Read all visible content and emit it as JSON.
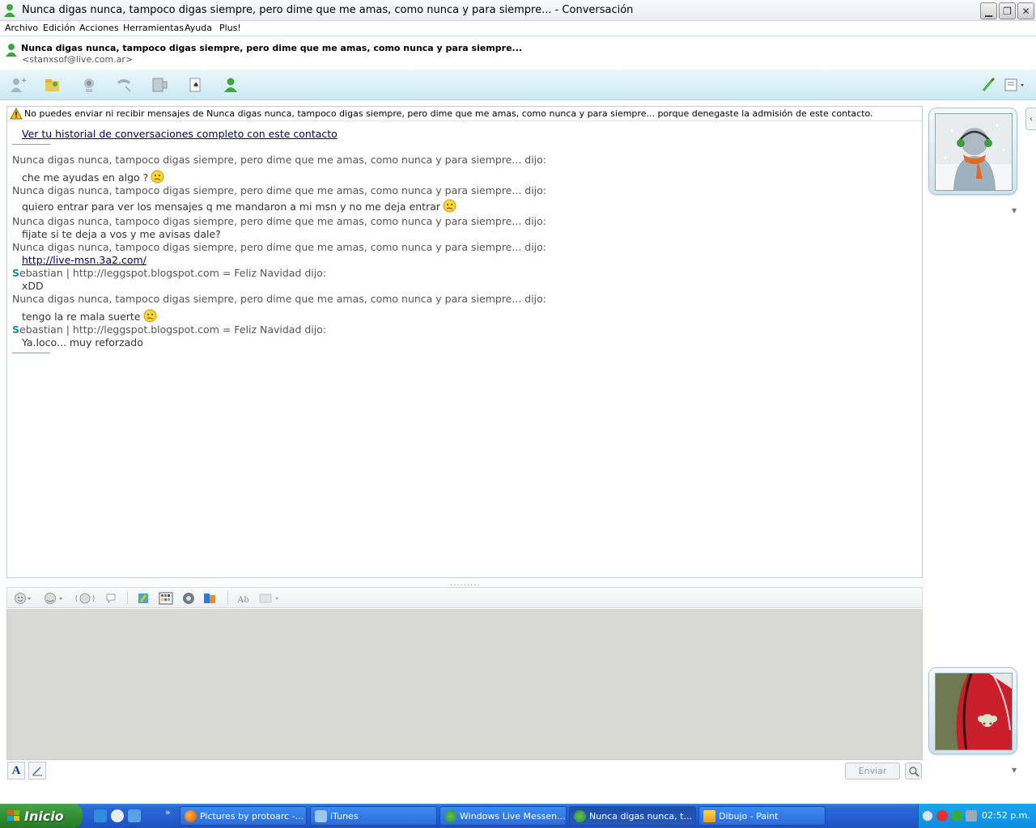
{
  "window": {
    "title": "Nunca digas nunca, tampoco digas siempre, pero dime que me amas, como nunca y para siempre... - Conversación"
  },
  "menu": [
    "Archivo",
    "Edición",
    "Acciones",
    "Herramientas",
    "Ayuda",
    "Plus!"
  ],
  "contact": {
    "name": "Nunca digas nunca, tampoco digas siempre, pero dime que me amas, como nunca y para siempre...",
    "email": "<stanxsof@live.com.ar>"
  },
  "toolbar": {
    "icons": [
      "invite-contact-icon",
      "send-files-icon",
      "webcam-icon",
      "call-icon",
      "video-icon",
      "games-icon",
      "contact-status-icon"
    ],
    "right_icons": [
      "paint-brush-icon",
      "options-menu-icon"
    ]
  },
  "conversation": {
    "warning": "No puedes enviar ni recibir mensajes de Nunca digas nunca, tampoco digas siempre, pero dime que me amas, como nunca y para siempre... porque denegaste la admisión de este contacto.",
    "history_link": "Ver tu historial de conversaciones completo con este contacto",
    "lines": [
      {
        "type": "sender",
        "text": "Nunca digas nunca, tampoco digas siempre, pero dime que me amas, como nunca y para siempre... dijo:"
      },
      {
        "type": "msg",
        "text": "che me ayudas en algo ?",
        "emoticon": "confused"
      },
      {
        "type": "sender",
        "text": "Nunca digas nunca, tampoco digas siempre, pero dime que me amas, como nunca y para siempre... dijo:"
      },
      {
        "type": "msg",
        "text": "quiero entrar para ver los mensajes q me mandaron a mi msn y no me deja entrar",
        "emoticon": "confused"
      },
      {
        "type": "sender",
        "text": "Nunca digas nunca, tampoco digas siempre, pero dime que me amas, como nunca y para siempre... dijo:"
      },
      {
        "type": "msg",
        "text": "fijate si te deja a vos y me avisas dale?"
      },
      {
        "type": "sender",
        "text": "Nunca digas nunca, tampoco digas siempre, pero dime que me amas, como nunca y para siempre... dijo:"
      },
      {
        "type": "link",
        "text": "http://live-msn.3a2.com/"
      },
      {
        "type": "sender-s",
        "initial": "S",
        "text": "ebastian | http://leggspot.blogspot.com = Feliz Navidad dijo:"
      },
      {
        "type": "msg",
        "text": "xDD"
      },
      {
        "type": "sender",
        "text": "Nunca digas nunca, tampoco digas siempre, pero dime que me amas, como nunca y para siempre... dijo:"
      },
      {
        "type": "msg",
        "text": "tengo la re mala suerte",
        "emoticon": "confused"
      },
      {
        "type": "sender-s",
        "initial": "S",
        "text": "ebastian | http://leggspot.blogspot.com = Feliz Navidad dijo:"
      },
      {
        "type": "msg",
        "text": "Ya.loco... muy reforzado"
      }
    ]
  },
  "compose": {
    "toolbar_icons": [
      "emoticon-icon",
      "wink-icon",
      "nudge-icon",
      "voice-clip-icon",
      "handwriting-icon",
      "backgrounds-icon",
      "sounds-icon",
      "plus-icon",
      "text-style-icon",
      "more-icon"
    ],
    "send_label": "Enviar"
  },
  "taskbar": {
    "start_label": "Inicio",
    "tasks": [
      {
        "label": "Pictures by protoarc -...",
        "icon": "firefox-icon"
      },
      {
        "label": "iTunes",
        "icon": "itunes-icon"
      },
      {
        "label": "Windows Live Messen...",
        "icon": "messenger-icon"
      },
      {
        "label": "Nunca digas nunca, t...",
        "icon": "messenger-icon",
        "active": true
      },
      {
        "label": "Dibujo - Paint",
        "icon": "paint-icon"
      }
    ],
    "clock": "02:52 p.m."
  },
  "colors": {
    "toolbar_gradient_top": "#eaf7fb",
    "toolbar_gradient_bottom": "#cbe9f3",
    "link": "#000066",
    "sender_text": "#555555",
    "compose_bg": "#d8d8d5",
    "taskbar": "#245dd0",
    "start_button": "#2f8a2f"
  }
}
